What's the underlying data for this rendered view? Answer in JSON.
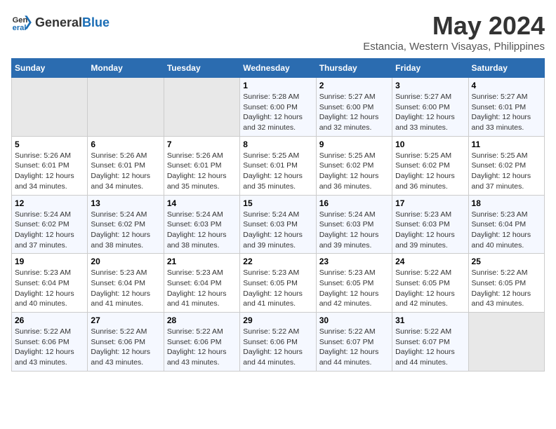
{
  "logo": {
    "text_general": "General",
    "text_blue": "Blue"
  },
  "title": "May 2024",
  "subtitle": "Estancia, Western Visayas, Philippines",
  "days_of_week": [
    "Sunday",
    "Monday",
    "Tuesday",
    "Wednesday",
    "Thursday",
    "Friday",
    "Saturday"
  ],
  "weeks": [
    [
      {
        "day": "",
        "empty": true
      },
      {
        "day": "",
        "empty": true
      },
      {
        "day": "",
        "empty": true
      },
      {
        "day": "1",
        "sunrise": "5:28 AM",
        "sunset": "6:00 PM",
        "daylight": "12 hours and 32 minutes."
      },
      {
        "day": "2",
        "sunrise": "5:27 AM",
        "sunset": "6:00 PM",
        "daylight": "12 hours and 32 minutes."
      },
      {
        "day": "3",
        "sunrise": "5:27 AM",
        "sunset": "6:00 PM",
        "daylight": "12 hours and 33 minutes."
      },
      {
        "day": "4",
        "sunrise": "5:27 AM",
        "sunset": "6:01 PM",
        "daylight": "12 hours and 33 minutes."
      }
    ],
    [
      {
        "day": "5",
        "sunrise": "5:26 AM",
        "sunset": "6:01 PM",
        "daylight": "12 hours and 34 minutes."
      },
      {
        "day": "6",
        "sunrise": "5:26 AM",
        "sunset": "6:01 PM",
        "daylight": "12 hours and 34 minutes."
      },
      {
        "day": "7",
        "sunrise": "5:26 AM",
        "sunset": "6:01 PM",
        "daylight": "12 hours and 35 minutes."
      },
      {
        "day": "8",
        "sunrise": "5:25 AM",
        "sunset": "6:01 PM",
        "daylight": "12 hours and 35 minutes."
      },
      {
        "day": "9",
        "sunrise": "5:25 AM",
        "sunset": "6:02 PM",
        "daylight": "12 hours and 36 minutes."
      },
      {
        "day": "10",
        "sunrise": "5:25 AM",
        "sunset": "6:02 PM",
        "daylight": "12 hours and 36 minutes."
      },
      {
        "day": "11",
        "sunrise": "5:25 AM",
        "sunset": "6:02 PM",
        "daylight": "12 hours and 37 minutes."
      }
    ],
    [
      {
        "day": "12",
        "sunrise": "5:24 AM",
        "sunset": "6:02 PM",
        "daylight": "12 hours and 37 minutes."
      },
      {
        "day": "13",
        "sunrise": "5:24 AM",
        "sunset": "6:02 PM",
        "daylight": "12 hours and 38 minutes."
      },
      {
        "day": "14",
        "sunrise": "5:24 AM",
        "sunset": "6:03 PM",
        "daylight": "12 hours and 38 minutes."
      },
      {
        "day": "15",
        "sunrise": "5:24 AM",
        "sunset": "6:03 PM",
        "daylight": "12 hours and 39 minutes."
      },
      {
        "day": "16",
        "sunrise": "5:24 AM",
        "sunset": "6:03 PM",
        "daylight": "12 hours and 39 minutes."
      },
      {
        "day": "17",
        "sunrise": "5:23 AM",
        "sunset": "6:03 PM",
        "daylight": "12 hours and 39 minutes."
      },
      {
        "day": "18",
        "sunrise": "5:23 AM",
        "sunset": "6:04 PM",
        "daylight": "12 hours and 40 minutes."
      }
    ],
    [
      {
        "day": "19",
        "sunrise": "5:23 AM",
        "sunset": "6:04 PM",
        "daylight": "12 hours and 40 minutes."
      },
      {
        "day": "20",
        "sunrise": "5:23 AM",
        "sunset": "6:04 PM",
        "daylight": "12 hours and 41 minutes."
      },
      {
        "day": "21",
        "sunrise": "5:23 AM",
        "sunset": "6:04 PM",
        "daylight": "12 hours and 41 minutes."
      },
      {
        "day": "22",
        "sunrise": "5:23 AM",
        "sunset": "6:05 PM",
        "daylight": "12 hours and 41 minutes."
      },
      {
        "day": "23",
        "sunrise": "5:23 AM",
        "sunset": "6:05 PM",
        "daylight": "12 hours and 42 minutes."
      },
      {
        "day": "24",
        "sunrise": "5:22 AM",
        "sunset": "6:05 PM",
        "daylight": "12 hours and 42 minutes."
      },
      {
        "day": "25",
        "sunrise": "5:22 AM",
        "sunset": "6:05 PM",
        "daylight": "12 hours and 43 minutes."
      }
    ],
    [
      {
        "day": "26",
        "sunrise": "5:22 AM",
        "sunset": "6:06 PM",
        "daylight": "12 hours and 43 minutes."
      },
      {
        "day": "27",
        "sunrise": "5:22 AM",
        "sunset": "6:06 PM",
        "daylight": "12 hours and 43 minutes."
      },
      {
        "day": "28",
        "sunrise": "5:22 AM",
        "sunset": "6:06 PM",
        "daylight": "12 hours and 43 minutes."
      },
      {
        "day": "29",
        "sunrise": "5:22 AM",
        "sunset": "6:06 PM",
        "daylight": "12 hours and 44 minutes."
      },
      {
        "day": "30",
        "sunrise": "5:22 AM",
        "sunset": "6:07 PM",
        "daylight": "12 hours and 44 minutes."
      },
      {
        "day": "31",
        "sunrise": "5:22 AM",
        "sunset": "6:07 PM",
        "daylight": "12 hours and 44 minutes."
      },
      {
        "day": "",
        "empty": true
      }
    ]
  ]
}
